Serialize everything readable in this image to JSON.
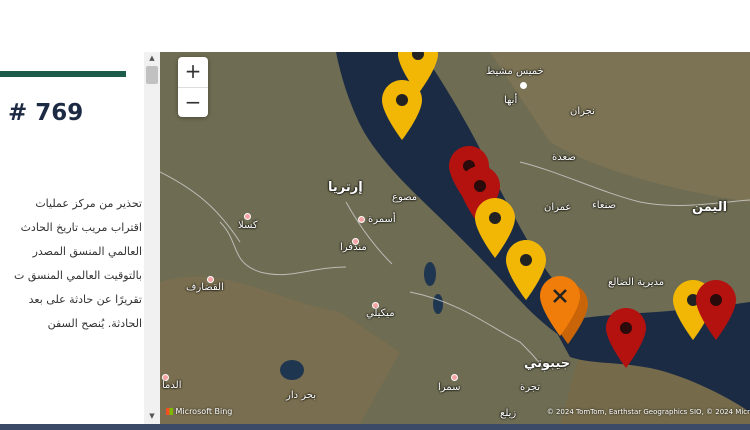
{
  "incident": {
    "number": "# 769"
  },
  "description_lines": [
    "تحذير من مركز عمليات",
    "اقتراب مريب تاريخ الحادث",
    "العالمي المنسق المصدر",
    "بالتوقيت العالمي المنسق ت",
    "تقريرًا عن حادثة على بعد",
    "الحادثة. يُنصح السفن"
  ],
  "map": {
    "zoom_in": "+",
    "zoom_out": "−",
    "attribution_logo": "Microsoft Bing",
    "copyright": "© 2024 TomTom, Earthstar Geographics SIO, © 2024 Micr",
    "labels": {
      "eritrea": "إرتريا",
      "yemen": "اليمن",
      "djibouti": "جيبوتي",
      "khamis": "خميس مشيط",
      "abha": "أبها",
      "najran": "نجران",
      "saada": "صعدة",
      "sanaa": "صنعاء",
      "amran": "عمران",
      "massawa": "مصوع",
      "asmara": "أسمرة",
      "kassala": "كسلا",
      "mendefera": "مندفرا",
      "gedaref": "القضارف",
      "mekele": "ميكيلي",
      "dhale": "مديرية الضالع",
      "semera": "سمرا",
      "tadjoura": "تجرة",
      "bahir_dar": "بحر دار",
      "damazin": "الدما",
      "zeila": "زيلع"
    },
    "pin_colors": {
      "yellow": "#f2b705",
      "red": "#b3120f",
      "orange": "#f07d0a"
    }
  }
}
